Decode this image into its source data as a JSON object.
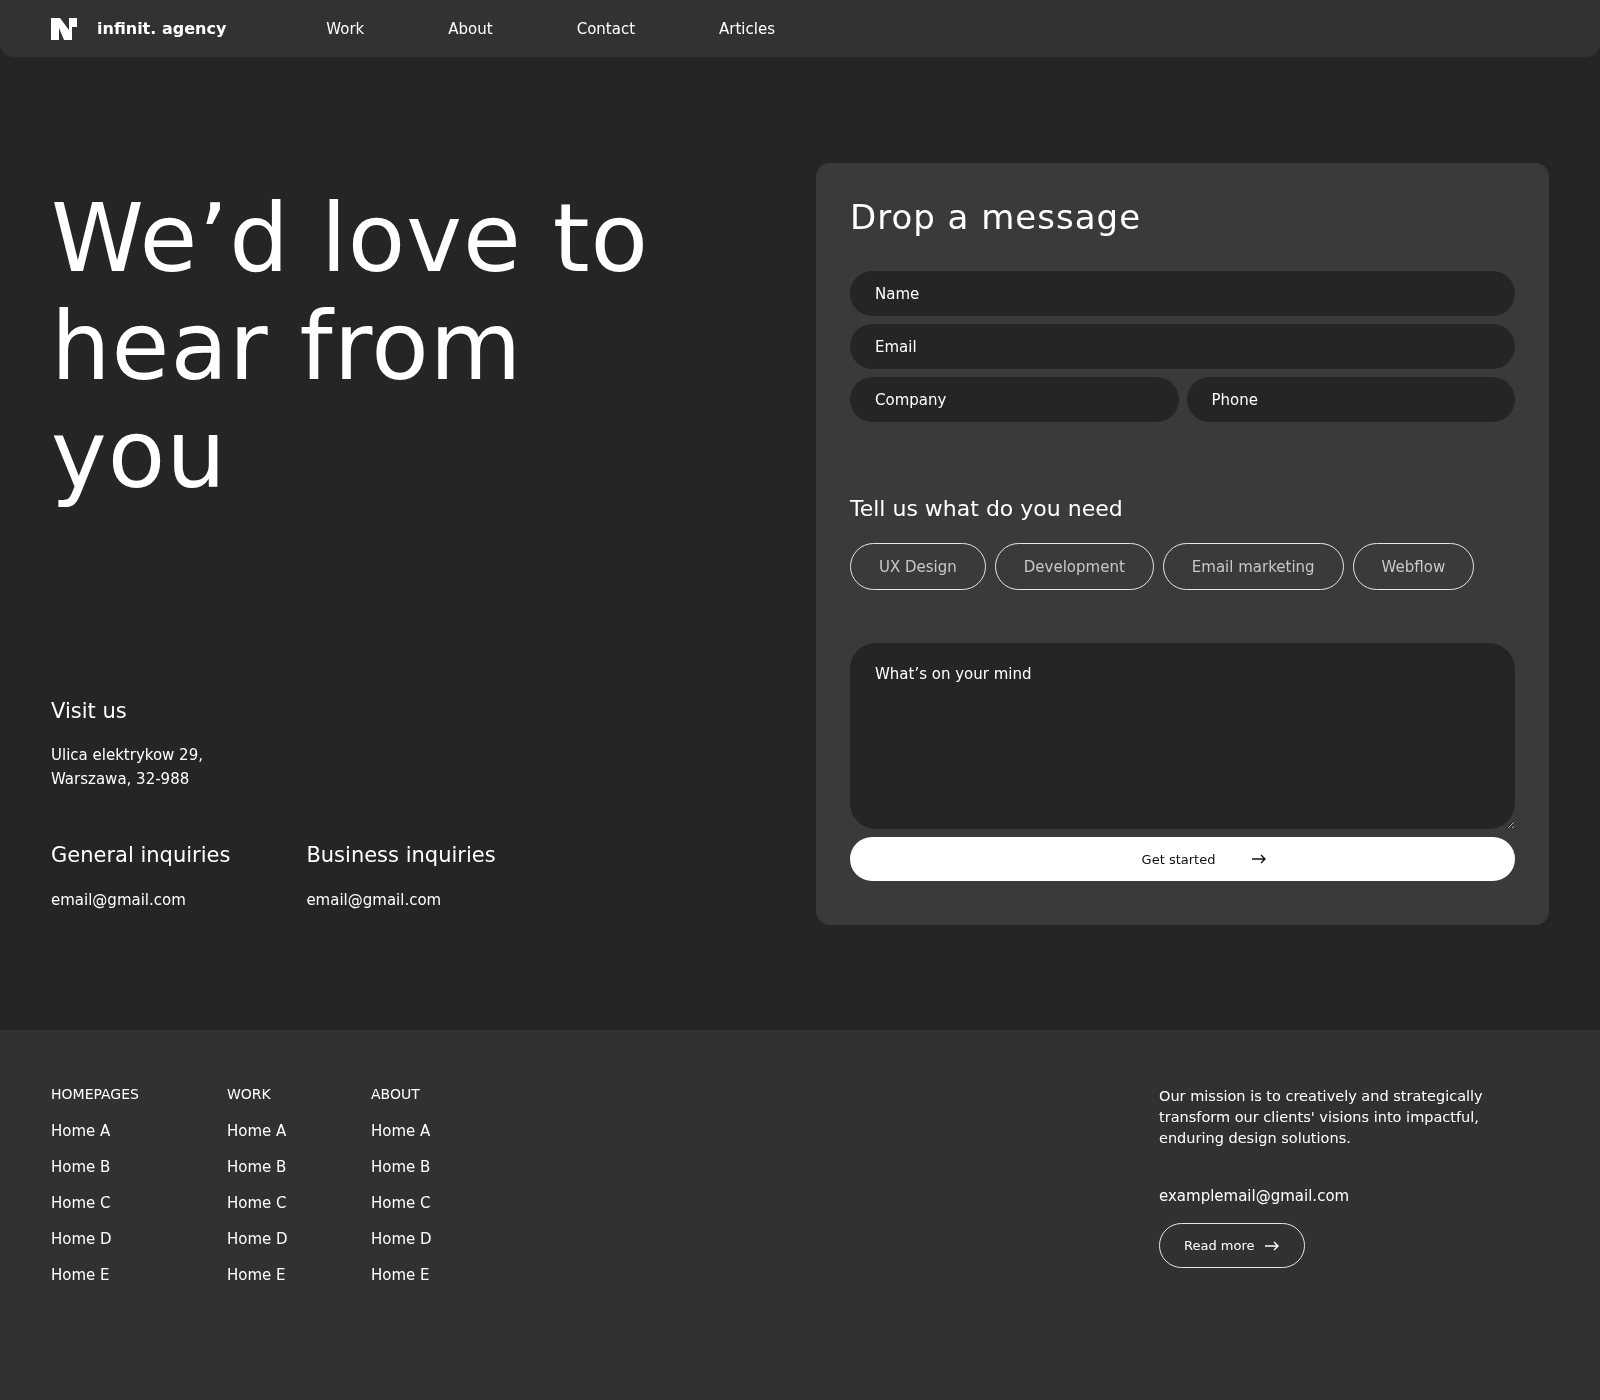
{
  "nav": {
    "brand": "infinit. agency",
    "links": [
      "Work",
      "About",
      "Contact",
      "Articles"
    ]
  },
  "hero": {
    "headline": "We’d love to hear from you"
  },
  "visit": {
    "title": "Visit us",
    "address_lines": [
      "Ulica elektrykow 29,",
      "Warszawa, 32-988"
    ]
  },
  "inquiries": [
    {
      "title": "General inquiries",
      "email": "email@gmail.com"
    },
    {
      "title": "Business inquiries",
      "email": "email@gmail.com"
    }
  ],
  "form": {
    "title": "Drop a message",
    "fields": [
      {
        "placeholder": "Name"
      },
      {
        "placeholder": "Email"
      },
      {
        "placeholder": "Company"
      },
      {
        "placeholder": "Phone"
      }
    ],
    "needs_title": "Tell us what do you need",
    "chips": [
      {
        "label": "UX Design",
        "selected": false
      },
      {
        "label": "Development",
        "selected": false
      },
      {
        "label": "Email marketing",
        "selected": false
      },
      {
        "label": "Webflow",
        "selected": false
      }
    ],
    "message_placeholder": "What’s on your mind",
    "submit": "Get started"
  },
  "footer": {
    "columns": [
      {
        "heading": "HOMEPAGES",
        "links": [
          "Home A",
          "Home B",
          "Home C",
          "Home D",
          "Home E"
        ]
      },
      {
        "heading": "WORK",
        "links": [
          "Home A",
          "Home B",
          "Home C",
          "Home D",
          "Home E"
        ]
      },
      {
        "heading": "ABOUT",
        "links": [
          "Home A",
          "Home B",
          "Home C",
          "Home D",
          "Home E"
        ]
      }
    ],
    "mission": "Our mission is to creatively and strategically transform our clients' visions into impactful, enduring design solutions.",
    "email": "examplemail@gmail.com",
    "read_more": "Read more"
  }
}
